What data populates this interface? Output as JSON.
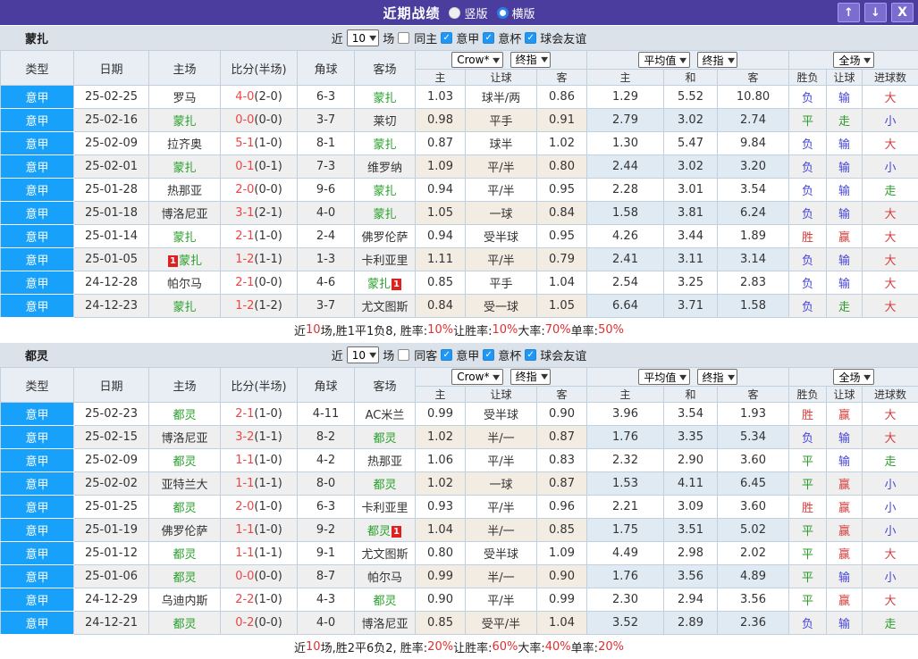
{
  "titlebar": {
    "title": "近期战绩",
    "vertical": "竖版",
    "horizontal": "横版"
  },
  "icons": {
    "up": "↑",
    "down": "↓",
    "close": "X",
    "check": "✓",
    "caret": "▼"
  },
  "colors": {
    "titlebar_purple": "#4a3d9e",
    "league_blue": "#18a1fa",
    "team_green": "#28a12b",
    "score_red": "#ee4545",
    "win_red": "#d43c3c",
    "draw_green": "#2b9b2b",
    "lose_blue": "#4646d6"
  },
  "table_header": {
    "cols": [
      "类型",
      "日期",
      "主场",
      "比分(半场)",
      "角球",
      "客场"
    ],
    "dd": {
      "bookmaker": "Crow*",
      "final1": "终指",
      "average": "平均值",
      "final2": "终指",
      "fullmatch": "全场"
    },
    "sub": [
      "主",
      "让球",
      "客",
      "主",
      "和",
      "客",
      "胜负",
      "让球",
      "进球数"
    ]
  },
  "sections": [
    {
      "team": "蒙扎",
      "filter": {
        "near": "近",
        "count": "10",
        "games": "场",
        "same": "同主",
        "leagues": [
          "意甲",
          "意杯",
          "球会友谊"
        ]
      },
      "rows": [
        {
          "league": "意甲",
          "date": "25-02-25",
          "home": "罗马",
          "home_green": false,
          "score": "4-0",
          "half": "(2-0)",
          "corners": "6-3",
          "away": "蒙扎",
          "away_green": true,
          "odds": [
            "1.03",
            "球半/两",
            "0.86"
          ],
          "avg": [
            "1.29",
            "5.52",
            "10.80"
          ],
          "results": [
            "负",
            "输",
            "大"
          ],
          "result_colors": [
            "blue",
            "blue",
            "red"
          ]
        },
        {
          "league": "意甲",
          "date": "25-02-16",
          "home": "蒙扎",
          "home_green": true,
          "score": "0-0",
          "half": "(0-0)",
          "corners": "3-7",
          "away": "莱切",
          "away_green": false,
          "odds": [
            "0.98",
            "平手",
            "0.91"
          ],
          "avg": [
            "2.79",
            "3.02",
            "2.74"
          ],
          "results": [
            "平",
            "走",
            "小"
          ],
          "result_colors": [
            "green",
            "green",
            "blue"
          ]
        },
        {
          "league": "意甲",
          "date": "25-02-09",
          "home": "拉齐奥",
          "home_green": false,
          "score": "5-1",
          "half": "(1-0)",
          "corners": "8-1",
          "away": "蒙扎",
          "away_green": true,
          "odds": [
            "0.87",
            "球半",
            "1.02"
          ],
          "avg": [
            "1.30",
            "5.47",
            "9.84"
          ],
          "results": [
            "负",
            "输",
            "大"
          ],
          "result_colors": [
            "blue",
            "blue",
            "red"
          ]
        },
        {
          "league": "意甲",
          "date": "25-02-01",
          "home": "蒙扎",
          "home_green": true,
          "score": "0-1",
          "half": "(0-1)",
          "corners": "7-3",
          "away": "维罗纳",
          "away_green": false,
          "odds": [
            "1.09",
            "平/半",
            "0.80"
          ],
          "avg": [
            "2.44",
            "3.02",
            "3.20"
          ],
          "results": [
            "负",
            "输",
            "小"
          ],
          "result_colors": [
            "blue",
            "blue",
            "blue"
          ]
        },
        {
          "league": "意甲",
          "date": "25-01-28",
          "home": "热那亚",
          "home_green": false,
          "score": "2-0",
          "half": "(0-0)",
          "corners": "9-6",
          "away": "蒙扎",
          "away_green": true,
          "odds": [
            "0.94",
            "平/半",
            "0.95"
          ],
          "avg": [
            "2.28",
            "3.01",
            "3.54"
          ],
          "results": [
            "负",
            "输",
            "走"
          ],
          "result_colors": [
            "blue",
            "blue",
            "green"
          ]
        },
        {
          "league": "意甲",
          "date": "25-01-18",
          "home": "博洛尼亚",
          "home_green": false,
          "score": "3-1",
          "half": "(2-1)",
          "corners": "4-0",
          "away": "蒙扎",
          "away_green": true,
          "odds": [
            "1.05",
            "一球",
            "0.84"
          ],
          "avg": [
            "1.58",
            "3.81",
            "6.24"
          ],
          "results": [
            "负",
            "输",
            "大"
          ],
          "result_colors": [
            "blue",
            "blue",
            "red"
          ]
        },
        {
          "league": "意甲",
          "date": "25-01-14",
          "home": "蒙扎",
          "home_green": true,
          "score": "2-1",
          "half": "(1-0)",
          "corners": "2-4",
          "away": "佛罗伦萨",
          "away_green": false,
          "odds": [
            "0.94",
            "受半球",
            "0.95"
          ],
          "avg": [
            "4.26",
            "3.44",
            "1.89"
          ],
          "results": [
            "胜",
            "赢",
            "大"
          ],
          "result_colors": [
            "red",
            "red",
            "red"
          ]
        },
        {
          "league": "意甲",
          "date": "25-01-05",
          "home": "蒙扎",
          "home_green": true,
          "home_badge_pre": "1",
          "score": "1-2",
          "half": "(1-1)",
          "corners": "1-3",
          "away": "卡利亚里",
          "away_green": false,
          "odds": [
            "1.11",
            "平/半",
            "0.79"
          ],
          "avg": [
            "2.41",
            "3.11",
            "3.14"
          ],
          "results": [
            "负",
            "输",
            "大"
          ],
          "result_colors": [
            "blue",
            "blue",
            "red"
          ]
        },
        {
          "league": "意甲",
          "date": "24-12-28",
          "home": "帕尔马",
          "home_green": false,
          "score": "2-1",
          "half": "(0-0)",
          "corners": "4-6",
          "away": "蒙扎",
          "away_green": true,
          "away_badge_post": "1",
          "odds": [
            "0.85",
            "平手",
            "1.04"
          ],
          "avg": [
            "2.54",
            "3.25",
            "2.83"
          ],
          "results": [
            "负",
            "输",
            "大"
          ],
          "result_colors": [
            "blue",
            "blue",
            "red"
          ]
        },
        {
          "league": "意甲",
          "date": "24-12-23",
          "home": "蒙扎",
          "home_green": true,
          "score": "1-2",
          "half": "(1-2)",
          "corners": "3-7",
          "away": "尤文图斯",
          "away_green": false,
          "odds": [
            "0.84",
            "受一球",
            "1.05"
          ],
          "avg": [
            "6.64",
            "3.71",
            "1.58"
          ],
          "results": [
            "负",
            "走",
            "大"
          ],
          "result_colors": [
            "blue",
            "green",
            "red"
          ]
        }
      ],
      "summary": [
        {
          "t": "近"
        },
        {
          "t": "10",
          "red": true
        },
        {
          "t": "场,胜1平1负8, 胜率:"
        },
        {
          "t": "10%",
          "red": true
        },
        {
          "t": " 让胜率:"
        },
        {
          "t": "10%",
          "red": true
        },
        {
          "t": " 大率:"
        },
        {
          "t": "70%",
          "red": true
        },
        {
          "t": " 单率:"
        },
        {
          "t": "50%",
          "red": true
        }
      ]
    },
    {
      "team": "都灵",
      "filter": {
        "near": "近",
        "count": "10",
        "games": "场",
        "same": "同客",
        "leagues": [
          "意甲",
          "意杯",
          "球会友谊"
        ]
      },
      "rows": [
        {
          "league": "意甲",
          "date": "25-02-23",
          "home": "都灵",
          "home_green": true,
          "score": "2-1",
          "half": "(1-0)",
          "corners": "4-11",
          "away": "AC米兰",
          "away_green": false,
          "odds": [
            "0.99",
            "受半球",
            "0.90"
          ],
          "avg": [
            "3.96",
            "3.54",
            "1.93"
          ],
          "results": [
            "胜",
            "赢",
            "大"
          ],
          "result_colors": [
            "red",
            "red",
            "red"
          ]
        },
        {
          "league": "意甲",
          "date": "25-02-15",
          "home": "博洛尼亚",
          "home_green": false,
          "score": "3-2",
          "half": "(1-1)",
          "corners": "8-2",
          "away": "都灵",
          "away_green": true,
          "odds": [
            "1.02",
            "半/一",
            "0.87"
          ],
          "avg": [
            "1.76",
            "3.35",
            "5.34"
          ],
          "results": [
            "负",
            "输",
            "大"
          ],
          "result_colors": [
            "blue",
            "blue",
            "red"
          ]
        },
        {
          "league": "意甲",
          "date": "25-02-09",
          "home": "都灵",
          "home_green": true,
          "score": "1-1",
          "half": "(1-0)",
          "corners": "4-2",
          "away": "热那亚",
          "away_green": false,
          "odds": [
            "1.06",
            "平/半",
            "0.83"
          ],
          "avg": [
            "2.32",
            "2.90",
            "3.60"
          ],
          "results": [
            "平",
            "输",
            "走"
          ],
          "result_colors": [
            "green",
            "blue",
            "green"
          ]
        },
        {
          "league": "意甲",
          "date": "25-02-02",
          "home": "亚特兰大",
          "home_green": false,
          "score": "1-1",
          "half": "(1-1)",
          "corners": "8-0",
          "away": "都灵",
          "away_green": true,
          "odds": [
            "1.02",
            "一球",
            "0.87"
          ],
          "avg": [
            "1.53",
            "4.11",
            "6.45"
          ],
          "results": [
            "平",
            "赢",
            "小"
          ],
          "result_colors": [
            "green",
            "red",
            "blue"
          ]
        },
        {
          "league": "意甲",
          "date": "25-01-25",
          "home": "都灵",
          "home_green": true,
          "score": "2-0",
          "half": "(1-0)",
          "corners": "6-3",
          "away": "卡利亚里",
          "away_green": false,
          "odds": [
            "0.93",
            "平/半",
            "0.96"
          ],
          "avg": [
            "2.21",
            "3.09",
            "3.60"
          ],
          "results": [
            "胜",
            "赢",
            "小"
          ],
          "result_colors": [
            "red",
            "red",
            "blue"
          ]
        },
        {
          "league": "意甲",
          "date": "25-01-19",
          "home": "佛罗伦萨",
          "home_green": false,
          "score": "1-1",
          "half": "(1-0)",
          "corners": "9-2",
          "away": "都灵",
          "away_green": true,
          "away_badge_post": "1",
          "odds": [
            "1.04",
            "半/一",
            "0.85"
          ],
          "avg": [
            "1.75",
            "3.51",
            "5.02"
          ],
          "results": [
            "平",
            "赢",
            "小"
          ],
          "result_colors": [
            "green",
            "red",
            "blue"
          ]
        },
        {
          "league": "意甲",
          "date": "25-01-12",
          "home": "都灵",
          "home_green": true,
          "score": "1-1",
          "half": "(1-1)",
          "corners": "9-1",
          "away": "尤文图斯",
          "away_green": false,
          "odds": [
            "0.80",
            "受半球",
            "1.09"
          ],
          "avg": [
            "4.49",
            "2.98",
            "2.02"
          ],
          "results": [
            "平",
            "赢",
            "大"
          ],
          "result_colors": [
            "green",
            "red",
            "red"
          ]
        },
        {
          "league": "意甲",
          "date": "25-01-06",
          "home": "都灵",
          "home_green": true,
          "score": "0-0",
          "half": "(0-0)",
          "corners": "8-7",
          "away": "帕尔马",
          "away_green": false,
          "odds": [
            "0.99",
            "半/一",
            "0.90"
          ],
          "avg": [
            "1.76",
            "3.56",
            "4.89"
          ],
          "results": [
            "平",
            "输",
            "小"
          ],
          "result_colors": [
            "green",
            "blue",
            "blue"
          ]
        },
        {
          "league": "意甲",
          "date": "24-12-29",
          "home": "乌迪内斯",
          "home_green": false,
          "score": "2-2",
          "half": "(1-0)",
          "corners": "4-3",
          "away": "都灵",
          "away_green": true,
          "odds": [
            "0.90",
            "平/半",
            "0.99"
          ],
          "avg": [
            "2.30",
            "2.94",
            "3.56"
          ],
          "results": [
            "平",
            "赢",
            "大"
          ],
          "result_colors": [
            "green",
            "red",
            "red"
          ]
        },
        {
          "league": "意甲",
          "date": "24-12-21",
          "home": "都灵",
          "home_green": true,
          "score": "0-2",
          "half": "(0-0)",
          "corners": "4-0",
          "away": "博洛尼亚",
          "away_green": false,
          "odds": [
            "0.85",
            "受平/半",
            "1.04"
          ],
          "avg": [
            "3.52",
            "2.89",
            "2.36"
          ],
          "results": [
            "负",
            "输",
            "走"
          ],
          "result_colors": [
            "blue",
            "blue",
            "green"
          ]
        }
      ],
      "summary": [
        {
          "t": "近"
        },
        {
          "t": "10",
          "red": true
        },
        {
          "t": "场,胜2平6负2, 胜率:"
        },
        {
          "t": "20%",
          "red": true
        },
        {
          "t": " 让胜率:"
        },
        {
          "t": "60%",
          "red": true
        },
        {
          "t": " 大率:"
        },
        {
          "t": "40%",
          "red": true
        },
        {
          "t": " 单率:"
        },
        {
          "t": "20%",
          "red": true
        }
      ]
    }
  ]
}
